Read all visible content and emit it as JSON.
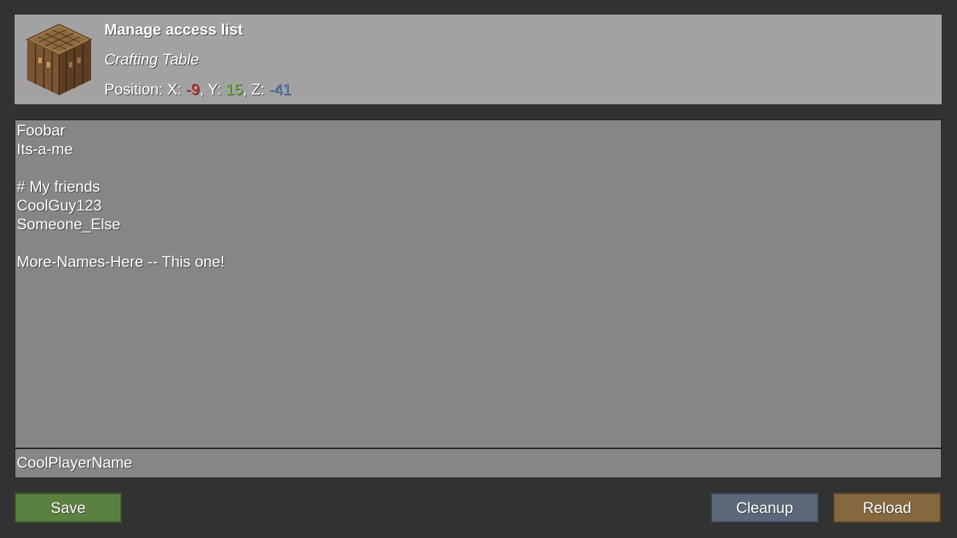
{
  "header": {
    "icon": "crafting-table-icon",
    "title": "Manage access list",
    "subtitle": "Crafting Table",
    "position": {
      "label": "Position: X: ",
      "x": "-9",
      "y_label": ", Y: ",
      "y": "15",
      "z_label": ", Z: ",
      "z": "-41"
    },
    "colors": {
      "x": "#d02323",
      "y": "#7fc24d",
      "z": "#5b8fc8"
    }
  },
  "access_list": {
    "lines": [
      "Foobar",
      "Its-a-me",
      "",
      "# My friends",
      "CoolGuy123",
      "Someone_Else",
      "",
      "More-Names-Here -- This one!"
    ]
  },
  "name_input": {
    "value": "CoolPlayerName"
  },
  "buttons": {
    "save": "Save",
    "cleanup": "Cleanup",
    "reload": "Reload"
  },
  "colors": {
    "background": "#323232",
    "header_bg": "#a2a2a2",
    "list_bg": "#868686",
    "save": "#5b8140",
    "cleanup": "#5a6878",
    "reload": "#86683e"
  }
}
